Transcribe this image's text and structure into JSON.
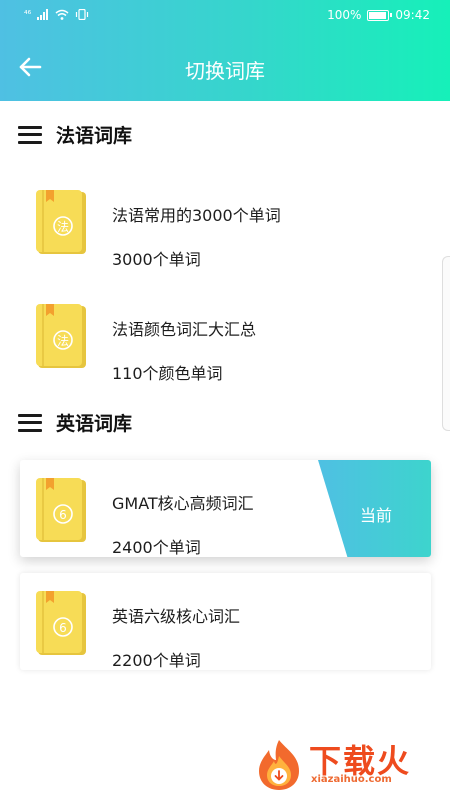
{
  "status_bar": {
    "signal": "⁴⁶",
    "battery_percent": "100%",
    "time": "09:42"
  },
  "header": {
    "title": "切换词库",
    "back_icon": "arrow-left-icon"
  },
  "sections": [
    {
      "title": "法语词库",
      "items": [
        {
          "badge": "法",
          "name": "法语常用的3000个单词",
          "count": "3000个单词"
        },
        {
          "badge": "法",
          "name": "法语颜色词汇大汇总",
          "count": "110个颜色单词"
        }
      ]
    },
    {
      "title": "英语词库",
      "items": [
        {
          "badge": "6",
          "name": "GMAT核心高频词汇",
          "count": "2400个单词",
          "current_label": "当前"
        },
        {
          "badge": "6",
          "name": "英语六级核心词汇",
          "count": "2200个单词"
        }
      ]
    }
  ],
  "watermark": {
    "brand": "下载火",
    "url": "xiazaihuo.com"
  },
  "colors": {
    "accent_start": "#4fc0e3",
    "accent_end": "#16f0b9",
    "book_yellow": "#f7dc56",
    "bookmark_orange": "#f3a12e",
    "watermark_red": "#ee4b1e"
  }
}
